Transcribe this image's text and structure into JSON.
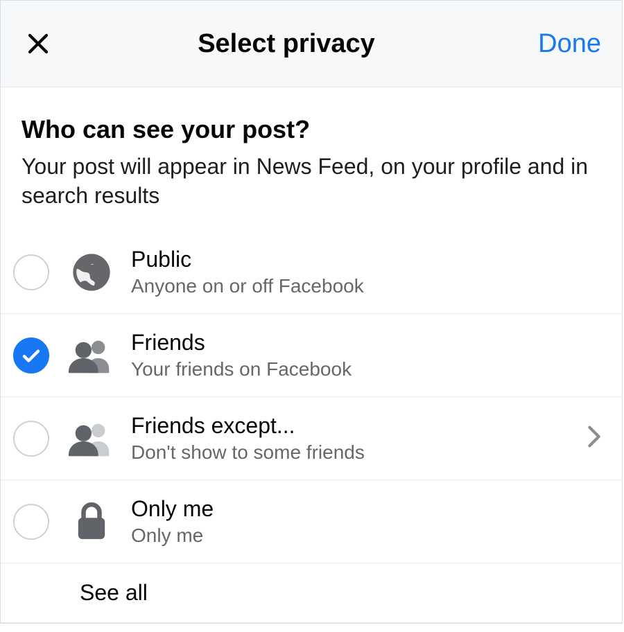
{
  "header": {
    "title": "Select privacy",
    "done_label": "Done"
  },
  "prompt": {
    "heading": "Who can see your post?",
    "sub": "Your post will appear in News Feed, on your profile and in search results"
  },
  "options": [
    {
      "id": "public",
      "title": "Public",
      "sub": "Anyone on or off Facebook",
      "selected": false,
      "has_chevron": false
    },
    {
      "id": "friends",
      "title": "Friends",
      "sub": "Your friends on Facebook",
      "selected": true,
      "has_chevron": false
    },
    {
      "id": "friends-except",
      "title": "Friends except...",
      "sub": "Don't show to some friends",
      "selected": false,
      "has_chevron": true
    },
    {
      "id": "only-me",
      "title": "Only me",
      "sub": "Only me",
      "selected": false,
      "has_chevron": false
    }
  ],
  "see_all_label": "See all"
}
